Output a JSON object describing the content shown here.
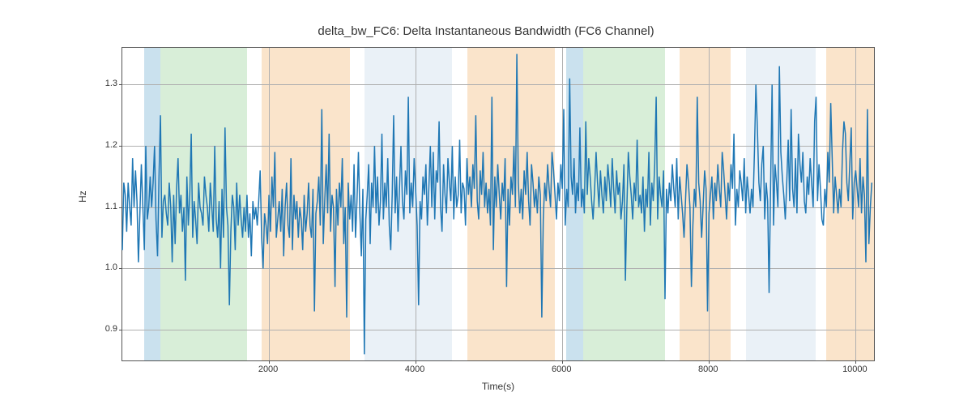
{
  "chart_data": {
    "type": "line",
    "title": "delta_bw_FC6: Delta Instantaneous Bandwidth (FC6 Channel)",
    "xlabel": "Time(s)",
    "ylabel": "Hz",
    "xlim": [
      0,
      10250
    ],
    "ylim": [
      0.85,
      1.36
    ],
    "xticks": [
      2000,
      4000,
      6000,
      8000,
      10000
    ],
    "yticks": [
      0.9,
      1.0,
      1.1,
      1.2,
      1.3
    ],
    "bands": [
      {
        "x0": 300,
        "x1": 520,
        "color": "#9ec8e0"
      },
      {
        "x0": 520,
        "x1": 1700,
        "color": "#b8e0b8"
      },
      {
        "x0": 1900,
        "x1": 3100,
        "color": "#f5cda0"
      },
      {
        "x0": 3300,
        "x1": 4500,
        "color": "#d8e5f0"
      },
      {
        "x0": 4700,
        "x1": 5900,
        "color": "#f5cda0"
      },
      {
        "x0": 6050,
        "x1": 6280,
        "color": "#9ec8e0"
      },
      {
        "x0": 6280,
        "x1": 7400,
        "color": "#b8e0b8"
      },
      {
        "x0": 7600,
        "x1": 8300,
        "color": "#f5cda0"
      },
      {
        "x0": 8500,
        "x1": 9450,
        "color": "#d8e5f0"
      },
      {
        "x0": 9600,
        "x1": 10250,
        "color": "#f5cda0"
      }
    ],
    "series": [
      {
        "name": "delta_bw_FC6",
        "color": "#1f77b4",
        "x_start": 0,
        "x_step": 20,
        "values": [
          1.03,
          1.14,
          1.12,
          1.06,
          1.14,
          1.1,
          1.07,
          1.18,
          1.1,
          1.16,
          1.11,
          1.01,
          1.09,
          1.17,
          1.1,
          1.03,
          1.2,
          1.08,
          1.1,
          1.15,
          1.1,
          1.14,
          1.2,
          1.08,
          1.02,
          1.15,
          1.25,
          1.05,
          1.11,
          1.12,
          1.09,
          1.07,
          1.14,
          1.1,
          1.01,
          1.12,
          1.04,
          1.13,
          1.18,
          1.09,
          1.12,
          1.06,
          1.1,
          0.98,
          1.15,
          1.07,
          1.12,
          1.22,
          1.05,
          1.11,
          1.08,
          1.04,
          1.14,
          1.1,
          1.09,
          1.07,
          1.15,
          1.12,
          1.1,
          1.06,
          1.14,
          1.1,
          1.06,
          1.2,
          1.08,
          1.05,
          1.11,
          1.0,
          1.13,
          1.05,
          1.23,
          1.1,
          1.07,
          0.94,
          1.06,
          1.12,
          1.1,
          1.03,
          1.14,
          1.07,
          1.12,
          1.08,
          1.05,
          1.1,
          1.06,
          1.12,
          1.05,
          1.09,
          1.02,
          1.11,
          1.08,
          1.1,
          1.07,
          1.11,
          1.16,
          1.05,
          1.0,
          1.09,
          1.07,
          1.04,
          1.12,
          1.06,
          1.15,
          1.1,
          1.19,
          1.05,
          1.08,
          1.11,
          1.06,
          1.13,
          1.02,
          1.1,
          1.14,
          1.07,
          1.05,
          1.18,
          1.03,
          1.12,
          1.08,
          1.11,
          1.05,
          1.1,
          1.08,
          1.03,
          1.12,
          1.06,
          1.09,
          1.14,
          1.07,
          1.05,
          1.13,
          0.93,
          1.09,
          1.11,
          1.15,
          1.07,
          1.26,
          1.04,
          1.11,
          1.17,
          1.09,
          1.22,
          1.06,
          1.12,
          1.1,
          0.97,
          1.13,
          1.07,
          1.14,
          1.1,
          1.18,
          1.04,
          1.1,
          0.92,
          1.14,
          1.08,
          1.12,
          1.06,
          1.17,
          1.05,
          1.11,
          1.19,
          1.09,
          1.02,
          1.13,
          0.86,
          1.08,
          1.12,
          1.17,
          1.04,
          1.14,
          1.1,
          1.2,
          1.09,
          1.15,
          1.07,
          1.11,
          1.22,
          1.08,
          1.14,
          1.1,
          1.18,
          1.07,
          1.03,
          1.12,
          1.25,
          1.09,
          1.15,
          1.06,
          1.13,
          1.2,
          1.11,
          1.08,
          1.16,
          1.12,
          1.28,
          1.09,
          1.14,
          1.1,
          1.18,
          1.13,
          1.07,
          0.94,
          1.11,
          1.08,
          1.15,
          1.12,
          1.17,
          1.07,
          1.13,
          1.2,
          1.1,
          1.19,
          1.08,
          1.16,
          1.14,
          1.24,
          1.1,
          1.06,
          1.17,
          1.12,
          1.09,
          1.18,
          1.14,
          1.11,
          1.2,
          1.08,
          1.15,
          1.1,
          1.12,
          1.21,
          1.09,
          1.14,
          1.13,
          1.07,
          1.18,
          1.12,
          1.15,
          1.1,
          1.17,
          1.13,
          1.25,
          1.11,
          1.08,
          1.16,
          1.12,
          1.19,
          1.1,
          1.14,
          1.09,
          1.13,
          1.07,
          1.28,
          1.03,
          1.15,
          1.1,
          1.17,
          1.12,
          1.08,
          1.14,
          1.11,
          1.18,
          0.97,
          1.13,
          1.07,
          1.15,
          1.12,
          1.2,
          1.1,
          1.35,
          1.14,
          1.09,
          1.13,
          1.08,
          1.16,
          1.12,
          1.19,
          1.11,
          1.07,
          1.17,
          1.14,
          1.1,
          1.13,
          1.09,
          1.15,
          1.12,
          0.92,
          1.08,
          1.14,
          1.11,
          1.17,
          1.13,
          1.1,
          1.19,
          1.16,
          1.12,
          1.08,
          1.14,
          1.11,
          1.17,
          1.13,
          1.26,
          1.07,
          1.13,
          1.1,
          1.31,
          1.15,
          1.12,
          1.18,
          1.09,
          1.14,
          1.11,
          1.23,
          1.1,
          1.13,
          1.09,
          1.24,
          1.12,
          1.18,
          1.15,
          1.11,
          1.08,
          1.13,
          1.19,
          1.14,
          1.1,
          1.16,
          1.12,
          1.09,
          1.15,
          1.11,
          1.17,
          1.14,
          1.1,
          1.18,
          1.13,
          1.09,
          1.16,
          1.12,
          1.14,
          1.08,
          1.11,
          1.17,
          0.98,
          1.1,
          1.19,
          1.15,
          1.12,
          1.08,
          1.14,
          1.11,
          1.21,
          1.1,
          1.12,
          1.09,
          1.15,
          1.06,
          1.13,
          1.1,
          1.19,
          1.07,
          1.14,
          1.11,
          1.17,
          1.28,
          1.08,
          1.15,
          1.12,
          1.1,
          1.16,
          0.95,
          1.13,
          1.09,
          1.14,
          1.11,
          1.17,
          1.13,
          1.1,
          1.18,
          1.08,
          1.15,
          1.12,
          1.09,
          1.05,
          1.11,
          1.17,
          1.14,
          1.1,
          0.97,
          1.07,
          1.13,
          1.1,
          1.28,
          1.14,
          1.11,
          1.05,
          1.1,
          1.16,
          1.13,
          0.93,
          1.09,
          1.12,
          1.15,
          1.08,
          1.14,
          1.11,
          1.17,
          1.13,
          1.1,
          1.19,
          1.16,
          1.12,
          1.08,
          1.14,
          1.11,
          1.17,
          1.13,
          1.22,
          1.07,
          1.13,
          1.1,
          1.16,
          1.14,
          1.11,
          1.18,
          1.09,
          1.15,
          1.12,
          1.09,
          1.13,
          1.1,
          1.19,
          1.3,
          1.23,
          1.14,
          1.11,
          1.17,
          1.2,
          1.08,
          1.14,
          1.11,
          0.96,
          1.13,
          1.3,
          1.07,
          1.17,
          1.14,
          1.1,
          1.33,
          1.19,
          1.15,
          1.12,
          1.08,
          1.14,
          1.21,
          1.11,
          1.26,
          1.13,
          1.1,
          1.18,
          1.09,
          1.22,
          1.17,
          1.14,
          1.19,
          1.11,
          1.09,
          1.15,
          1.12,
          1.18,
          1.14,
          1.1,
          1.24,
          1.28,
          1.11,
          1.17,
          1.13,
          1.08,
          1.07,
          1.13,
          1.1,
          1.19,
          1.14,
          1.27,
          1.18,
          1.09,
          1.15,
          1.12,
          1.09,
          1.13,
          1.1,
          1.19,
          1.24,
          1.22,
          1.14,
          1.11,
          1.17,
          1.23,
          1.08,
          1.14,
          1.16,
          1.13,
          1.1,
          1.18,
          1.09,
          1.15,
          1.12,
          1.01,
          1.26,
          1.04,
          1.1,
          1.14
        ]
      }
    ]
  }
}
